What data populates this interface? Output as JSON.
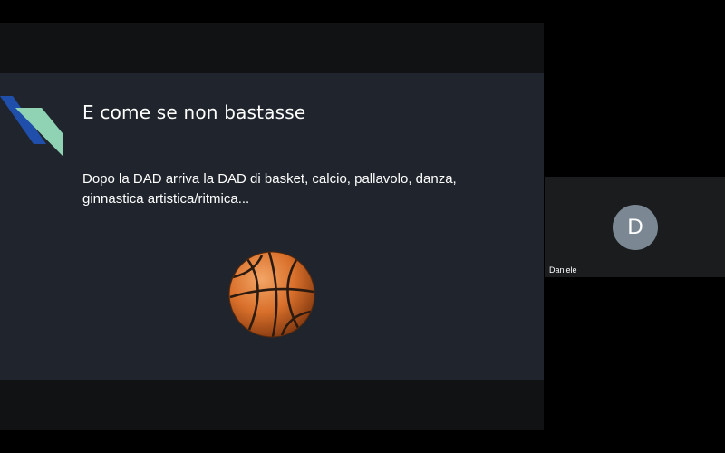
{
  "presentation": {
    "title": "E come se non bastasse",
    "body": "Dopo la DAD arriva la DAD di basket, calcio, pallavolo, danza, ginnastica artistica/ritmica...",
    "image_icon": "basketball-icon",
    "decoration_colors": [
      "#1f4faa",
      "#8fd3b4"
    ]
  },
  "participant": {
    "initial": "D",
    "name": "Daniele",
    "avatar_color": "#7b8894"
  }
}
